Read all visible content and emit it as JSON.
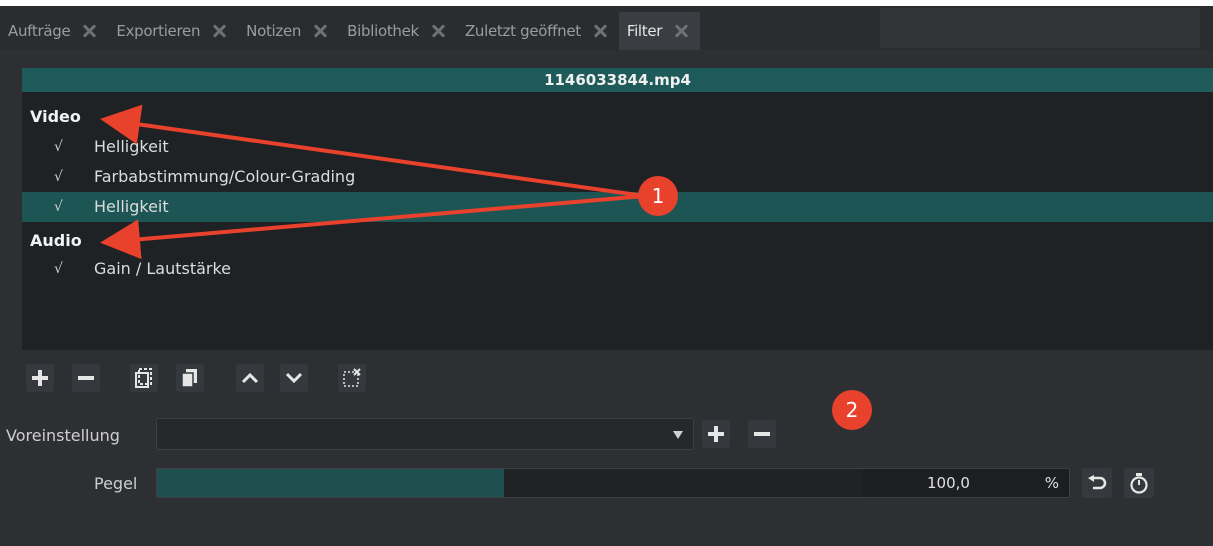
{
  "tabs": [
    {
      "label": "Aufträge",
      "active": false
    },
    {
      "label": "Exportieren",
      "active": false
    },
    {
      "label": "Notizen",
      "active": false
    },
    {
      "label": "Bibliothek",
      "active": false
    },
    {
      "label": "Zuletzt geöffnet",
      "active": false
    },
    {
      "label": "Filter",
      "active": true
    }
  ],
  "clip": {
    "name": "1146033844.mp4"
  },
  "filters": {
    "video_group": "Video",
    "video_items": [
      {
        "check": "√",
        "label": "Helligkeit"
      },
      {
        "check": "√",
        "label": "Farbabstimmung/Colour-Grading"
      },
      {
        "check": "√",
        "label": "Helligkeit",
        "selected": true
      }
    ],
    "audio_group": "Audio",
    "audio_items": [
      {
        "check": "√",
        "label": "Gain / Lautstärke"
      }
    ]
  },
  "toolbar": {
    "add": "+",
    "remove": "−",
    "icons": [
      "plus-icon",
      "minus-icon",
      "copy-icon",
      "paste-icon",
      "move-up-icon",
      "move-down-icon",
      "deselect-icon"
    ]
  },
  "preset": {
    "label": "Voreinstellung",
    "value": "",
    "add": "+",
    "remove": "−"
  },
  "level": {
    "label": "Pegel",
    "value": "100,0",
    "unit": "%",
    "fill_fraction": 0.38
  },
  "annotations": {
    "badge1": "1",
    "badge2": "2"
  },
  "colors": {
    "accent": "#1e5a5a",
    "badge": "#e8412c"
  }
}
